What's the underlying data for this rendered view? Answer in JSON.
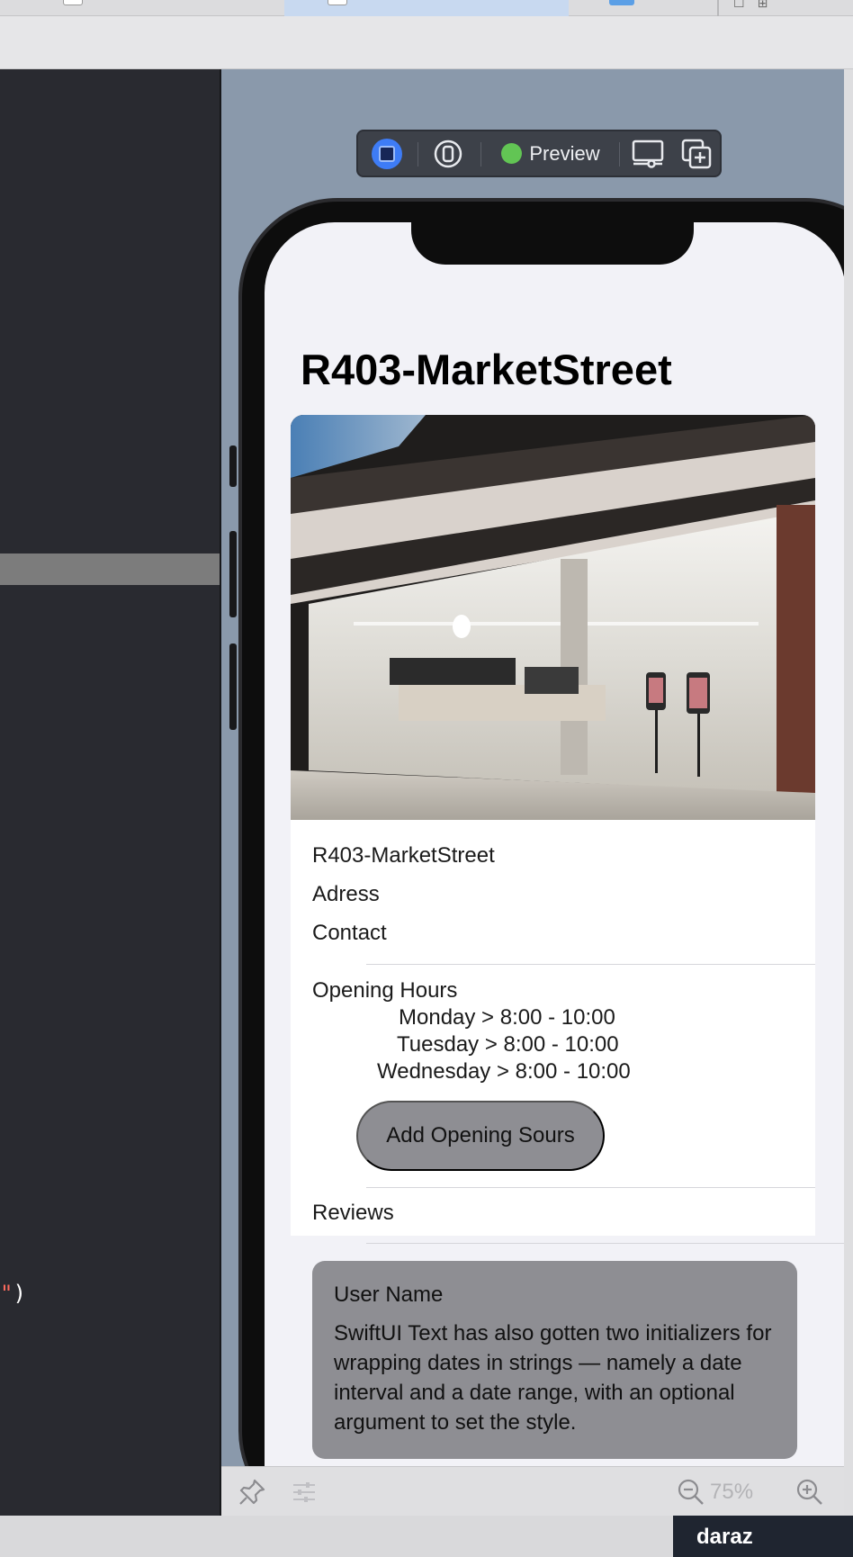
{
  "top_tab_bar": {
    "right_icons": [
      "layout-icon",
      "library-icon"
    ]
  },
  "code_editor": {
    "visible_fragment": "\")"
  },
  "preview_toolbar": {
    "live_button": "live-preview-icon",
    "variants_button": "variants-icon",
    "preview_label": "Preview",
    "preview_status_color": "#62C554",
    "device_settings_button": "device-settings-icon",
    "duplicate_button": "duplicate-preview-icon"
  },
  "app": {
    "nav_title": "R403-MarketStreet",
    "store_photo": "apple-store-photo",
    "info": {
      "name": "R403-MarketStreet",
      "address": "Adress",
      "contact": "Contact"
    },
    "opening_hours": {
      "title": "Opening Hours",
      "entries": [
        "Monday > 8:00 - 10:00",
        "Tuesday > 8:00 - 10:00",
        "Wednesday > 8:00 - 10:00"
      ],
      "add_button": "Add Opening Sours"
    },
    "reviews": {
      "title": "Reviews",
      "items": [
        {
          "user": "User Name",
          "text": "SwiftUI Text has also gotten two initializers for wrapping dates in strings — namely a date interval and a date range, with an optional argument to set the style."
        }
      ]
    }
  },
  "canvas_bottom_bar": {
    "pin_icon": "pin-icon",
    "adjust_icon": "adjustments-icon",
    "zoom_level": "75%"
  },
  "status_bar": {
    "brand": "daraz"
  }
}
